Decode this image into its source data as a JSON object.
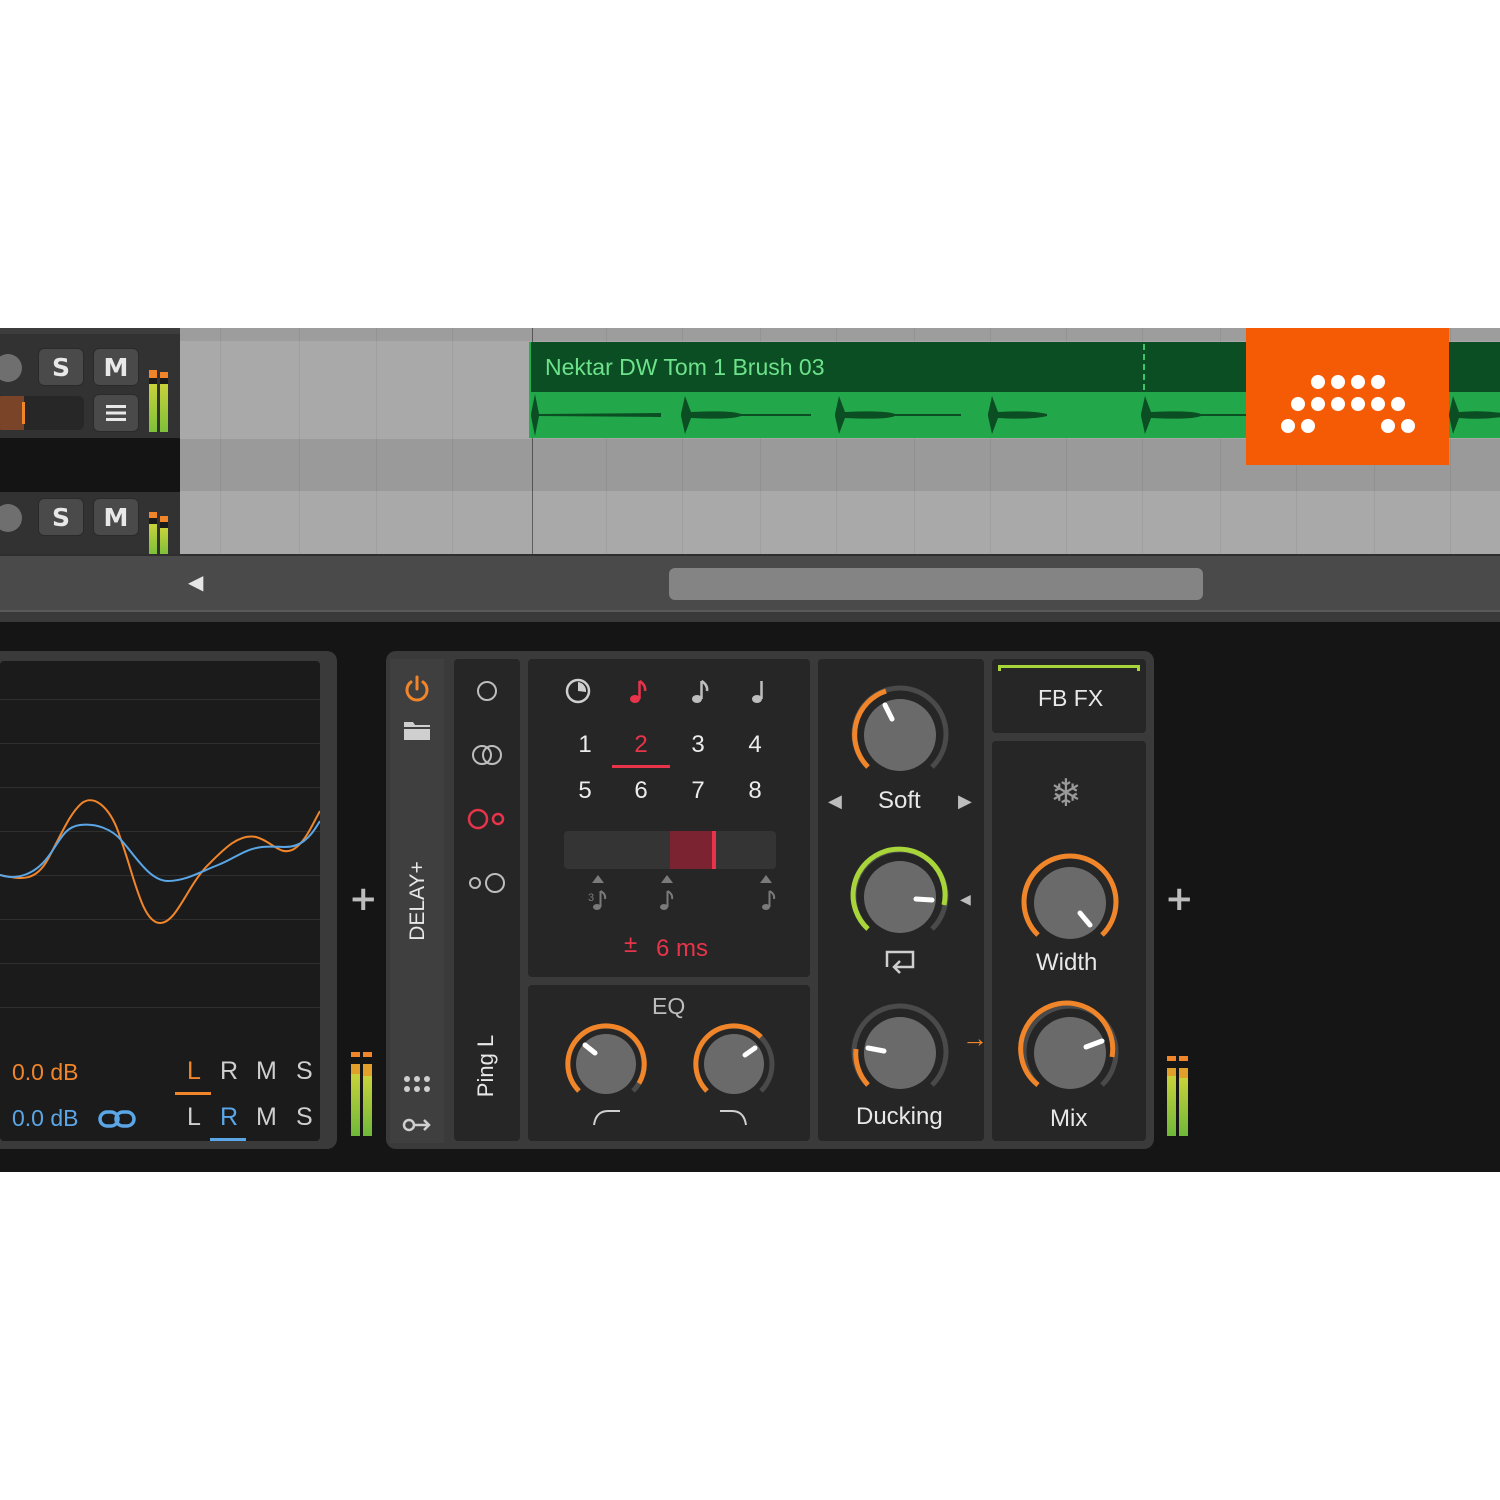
{
  "colors": {
    "clip_green": "#22a84a",
    "clip_dark": "#0b4e23",
    "accent_orange": "#f0852a",
    "accent_red": "#e8344a",
    "accent_blue": "#5aa6e6",
    "accent_lime": "#a8d63a",
    "logo_orange": "#f55a05"
  },
  "tracks": [
    {
      "solo_label": "S",
      "mute_label": "M"
    },
    {
      "solo_label": "S",
      "mute_label": "M"
    }
  ],
  "clip": {
    "title": "Nektar DW Tom 1 Brush 03"
  },
  "logo": {
    "icon": "bitwig-logo-icon"
  },
  "scope": {
    "left_gain": "0.0 dB",
    "right_gain": "0.0 dB",
    "row1": [
      "L",
      "R",
      "M",
      "S"
    ],
    "row2": [
      "L",
      "R",
      "M",
      "S"
    ],
    "link_icon": "link-icon"
  },
  "add_device_label": "+",
  "delay": {
    "device_name": "DELAY+",
    "preset_name": "Ping L",
    "sync_numbers": [
      "1",
      "2",
      "3",
      "4",
      "5",
      "6",
      "7",
      "8"
    ],
    "selected_number": "2",
    "timing_offset": "6 ms",
    "timing_sign": "±",
    "eq_label": "EQ",
    "soft_label": "Soft",
    "ducking_label": "Ducking",
    "fbfx_label": "FB FX",
    "width_label": "Width",
    "mix_label": "Mix"
  }
}
